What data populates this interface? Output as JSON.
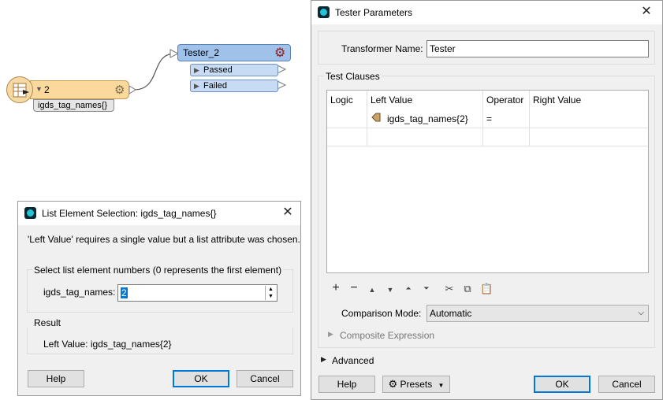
{
  "canvas": {
    "reader": {
      "port_number": "2",
      "attribute": "igds_tag_names{}"
    },
    "tester": {
      "title": "Tester_2",
      "ports": [
        "Passed",
        "Failed"
      ]
    }
  },
  "list_dialog": {
    "title": "List Element Selection: igds_tag_names{}",
    "message": "'Left Value' requires a single value but a list attribute was chosen.",
    "select_group_label": "Select list element numbers (0 represents the first element)",
    "field_label": "igds_tag_names:",
    "field_value": "2",
    "result_label": "Result",
    "result_text": "Left Value:  igds_tag_names{2}",
    "help": "Help",
    "ok": "OK",
    "cancel": "Cancel"
  },
  "tester_dialog": {
    "title": "Tester Parameters",
    "transformer_name_label": "Transformer Name:",
    "transformer_name_value": "Tester",
    "test_clauses_label": "Test Clauses",
    "columns": [
      "Logic",
      "Left Value",
      "Operator",
      "Right Value"
    ],
    "row": {
      "logic": "",
      "left_value": "igds_tag_names{2}",
      "operator": "=",
      "right_value": ""
    },
    "comparison_mode_label": "Comparison Mode:",
    "comparison_mode_value": "Automatic",
    "composite_expression": "Composite Expression",
    "advanced": "Advanced",
    "help": "Help",
    "presets": "Presets",
    "ok": "OK",
    "cancel": "Cancel"
  },
  "colors": {
    "accent": "#0078d7",
    "reader": "#fbd99c",
    "tester": "#9fc1ea",
    "gear": "#8b1d1d"
  }
}
